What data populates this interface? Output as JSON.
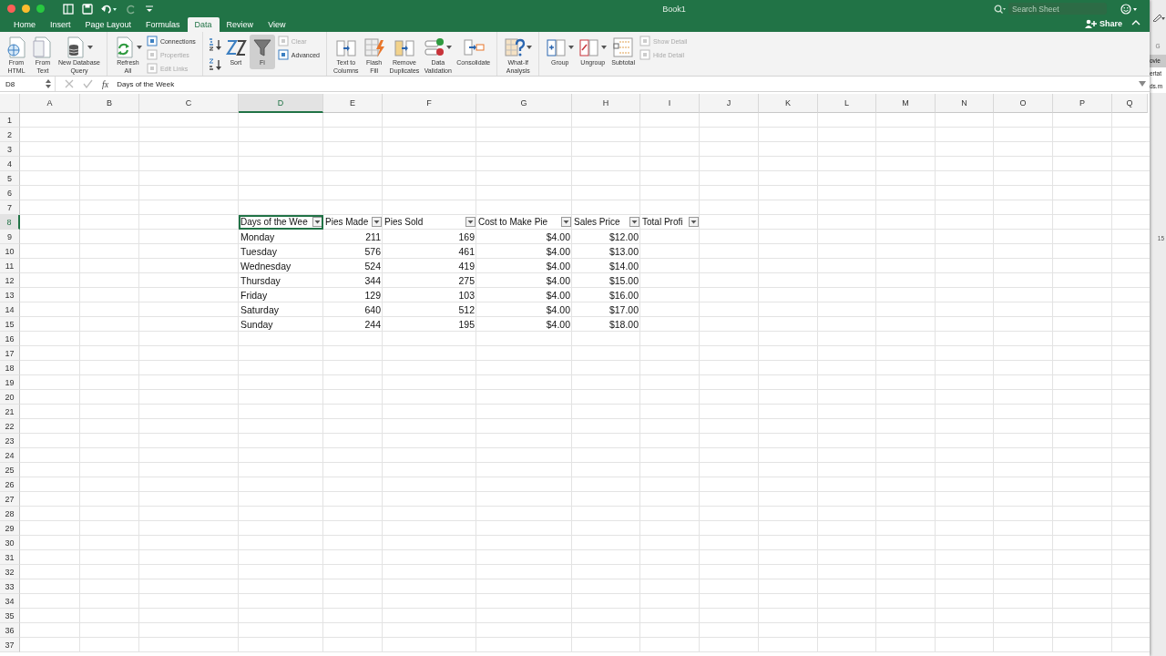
{
  "window": {
    "title": "Book1"
  },
  "search": {
    "placeholder": "Search Sheet"
  },
  "share_button": {
    "label": "Share"
  },
  "tabs": [
    {
      "label": "Home",
      "selected": false
    },
    {
      "label": "Insert",
      "selected": false
    },
    {
      "label": "Page Layout",
      "selected": false
    },
    {
      "label": "Formulas",
      "selected": false
    },
    {
      "label": "Data",
      "selected": true
    },
    {
      "label": "Review",
      "selected": false
    },
    {
      "label": "View",
      "selected": false
    }
  ],
  "ribbon": {
    "groups": [
      {
        "items": [
          {
            "kind": "large",
            "lines": [
              "From",
              "HTML"
            ],
            "menu": false,
            "pressed": false
          },
          {
            "kind": "large",
            "lines": [
              "From",
              "Text"
            ],
            "menu": false,
            "pressed": false
          },
          {
            "kind": "large",
            "lines": [
              "New Database",
              "Query"
            ],
            "menu": true,
            "pressed": false
          }
        ]
      },
      {
        "items": [
          {
            "kind": "large",
            "lines": [
              "Refresh",
              "All"
            ],
            "menu": true,
            "pressed": false
          },
          {
            "kind": "stack",
            "entries": [
              {
                "label": "Connections",
                "disabled": false
              },
              {
                "label": "Properties",
                "disabled": true
              },
              {
                "label": "Edit Links",
                "disabled": true
              }
            ]
          }
        ]
      },
      {
        "items": [
          {
            "kind": "sortpair"
          },
          {
            "kind": "large",
            "lines": [
              "Sort"
            ],
            "menu": false,
            "pressed": false
          },
          {
            "kind": "large",
            "lines": [
              "Fi"
            ],
            "menu": false,
            "pressed": true
          },
          {
            "kind": "stack",
            "entries": [
              {
                "label": "Clear",
                "disabled": true
              },
              {
                "label": "Advanced",
                "disabled": false
              }
            ]
          }
        ]
      },
      {
        "items": [
          {
            "kind": "large",
            "lines": [
              "Text to",
              "Columns"
            ],
            "menu": false,
            "pressed": false
          },
          {
            "kind": "large",
            "lines": [
              "Flash",
              "Fill"
            ],
            "menu": false,
            "pressed": false
          },
          {
            "kind": "large",
            "lines": [
              "Remove",
              "Duplicates"
            ],
            "menu": false,
            "pressed": false
          },
          {
            "kind": "large",
            "lines": [
              "Data",
              "Validation"
            ],
            "menu": true,
            "pressed": false
          },
          {
            "kind": "large",
            "lines": [
              "Consolidate"
            ],
            "menu": false,
            "pressed": false
          }
        ]
      },
      {
        "items": [
          {
            "kind": "large",
            "lines": [
              "What-If",
              "Analysis"
            ],
            "menu": true,
            "pressed": false
          }
        ]
      },
      {
        "items": [
          {
            "kind": "large",
            "lines": [
              "Group"
            ],
            "menu": true,
            "pressed": false
          },
          {
            "kind": "large",
            "lines": [
              "Ungroup"
            ],
            "menu": true,
            "pressed": false
          },
          {
            "kind": "large",
            "lines": [
              "Subtotal"
            ],
            "menu": false,
            "pressed": false
          },
          {
            "kind": "stack",
            "entries": [
              {
                "label": "Show Detail",
                "disabled": true
              },
              {
                "label": "Hide Detail",
                "disabled": true
              }
            ]
          }
        ]
      }
    ]
  },
  "formula_bar": {
    "name_box": "D8",
    "function_label": "fx",
    "formula": "Days of the Week"
  },
  "sheet": {
    "column_headers": [
      {
        "label": "A",
        "selected": false
      },
      {
        "label": "B",
        "selected": false
      },
      {
        "label": "C",
        "selected": false
      },
      {
        "label": "D",
        "selected": true
      },
      {
        "label": "E",
        "selected": false
      },
      {
        "label": "F",
        "selected": false
      },
      {
        "label": "G",
        "selected": false
      },
      {
        "label": "H",
        "selected": false
      },
      {
        "label": "I",
        "selected": false
      },
      {
        "label": "J",
        "selected": false
      },
      {
        "label": "K",
        "selected": false
      },
      {
        "label": "L",
        "selected": false
      },
      {
        "label": "M",
        "selected": false
      },
      {
        "label": "N",
        "selected": false
      },
      {
        "label": "O",
        "selected": false
      },
      {
        "label": "P",
        "selected": false
      },
      {
        "label": "Q",
        "selected": false
      }
    ],
    "row_headers": [
      {
        "label": "1",
        "selected": false
      },
      {
        "label": "2",
        "selected": false
      },
      {
        "label": "3",
        "selected": false
      },
      {
        "label": "4",
        "selected": false
      },
      {
        "label": "5",
        "selected": false
      },
      {
        "label": "6",
        "selected": false
      },
      {
        "label": "7",
        "selected": false
      },
      {
        "label": "8",
        "selected": true
      },
      {
        "label": "9",
        "selected": false
      },
      {
        "label": "10",
        "selected": false
      },
      {
        "label": "11",
        "selected": false
      },
      {
        "label": "12",
        "selected": false
      },
      {
        "label": "13",
        "selected": false
      },
      {
        "label": "14",
        "selected": false
      },
      {
        "label": "15",
        "selected": false
      },
      {
        "label": "16",
        "selected": false
      },
      {
        "label": "17",
        "selected": false
      },
      {
        "label": "18",
        "selected": false
      },
      {
        "label": "19",
        "selected": false
      },
      {
        "label": "20",
        "selected": false
      },
      {
        "label": "21",
        "selected": false
      },
      {
        "label": "22",
        "selected": false
      },
      {
        "label": "23",
        "selected": false
      },
      {
        "label": "24",
        "selected": false
      },
      {
        "label": "25",
        "selected": false
      },
      {
        "label": "26",
        "selected": false
      },
      {
        "label": "27",
        "selected": false
      },
      {
        "label": "28",
        "selected": false
      },
      {
        "label": "29",
        "selected": false
      },
      {
        "label": "30",
        "selected": false
      },
      {
        "label": "31",
        "selected": false
      },
      {
        "label": "32",
        "selected": false
      },
      {
        "label": "33",
        "selected": false
      },
      {
        "label": "34",
        "selected": false
      },
      {
        "label": "35",
        "selected": false
      },
      {
        "label": "36",
        "selected": false
      },
      {
        "label": "37",
        "selected": false
      }
    ],
    "table": {
      "columns": [
        {
          "label": "Days of the Wee",
          "active": true
        },
        {
          "label": "Pies Made",
          "active": false
        },
        {
          "label": "Pies Sold",
          "active": false
        },
        {
          "label": "Cost to Make Pie",
          "active": false
        },
        {
          "label": "Sales Price",
          "active": false
        },
        {
          "label": "Total Profi",
          "active": false
        }
      ],
      "rows": [
        [
          "Monday",
          "211",
          "169",
          "$4.00",
          "$12.00"
        ],
        [
          "Tuesday",
          "576",
          "461",
          "$4.00",
          "$13.00"
        ],
        [
          "Wednesday",
          "524",
          "419",
          "$4.00",
          "$14.00"
        ],
        [
          "Thursday",
          "344",
          "275",
          "$4.00",
          "$15.00"
        ],
        [
          "Friday",
          "129",
          "103",
          "$4.00",
          "$16.00"
        ],
        [
          "Saturday",
          "640",
          "512",
          "$4.00",
          "$17.00"
        ],
        [
          "Sunday",
          "244",
          "195",
          "$4.00",
          "$18.00"
        ]
      ]
    }
  },
  "background_window": {
    "column_header": "G",
    "cells": [
      {
        "text": "ovie",
        "selected": true
      },
      {
        "text": "ertat",
        "selected": false
      },
      {
        "text": "ds.m",
        "selected": false
      }
    ],
    "lower_cell": "15"
  }
}
